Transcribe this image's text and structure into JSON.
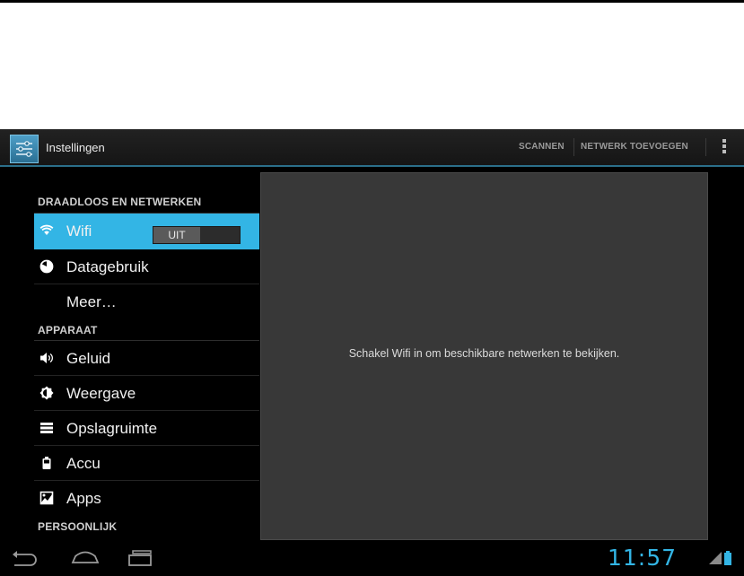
{
  "action_bar": {
    "title": "Instellingen",
    "actions": [
      "SCANNEN",
      "NETWERK TOEVOEGEN"
    ]
  },
  "settings": {
    "sections": [
      {
        "header": "DRAADLOOS EN NETWERKEN",
        "items": [
          {
            "label": "Wifi",
            "icon": "wifi-icon",
            "selected": true,
            "toggle": "UIT"
          },
          {
            "label": "Datagebruik",
            "icon": "data-usage-icon"
          },
          {
            "label": "Meer…",
            "icon": ""
          }
        ]
      },
      {
        "header": "APPARAAT",
        "items": [
          {
            "label": "Geluid",
            "icon": "speaker-icon"
          },
          {
            "label": "Weergave",
            "icon": "brightness-icon"
          },
          {
            "label": "Opslagruimte",
            "icon": "storage-icon"
          },
          {
            "label": "Accu",
            "icon": "battery-icon"
          },
          {
            "label": "Apps",
            "icon": "apps-icon"
          }
        ]
      },
      {
        "header": "PERSOONLIJK",
        "items": []
      }
    ]
  },
  "detail_pane": {
    "message": "Schakel Wifi in om beschikbare netwerken te bekijken."
  },
  "status_bar": {
    "time": "11:57"
  },
  "colors": {
    "accent": "#33b5e5",
    "background": "#000000",
    "pane": "#383838"
  }
}
